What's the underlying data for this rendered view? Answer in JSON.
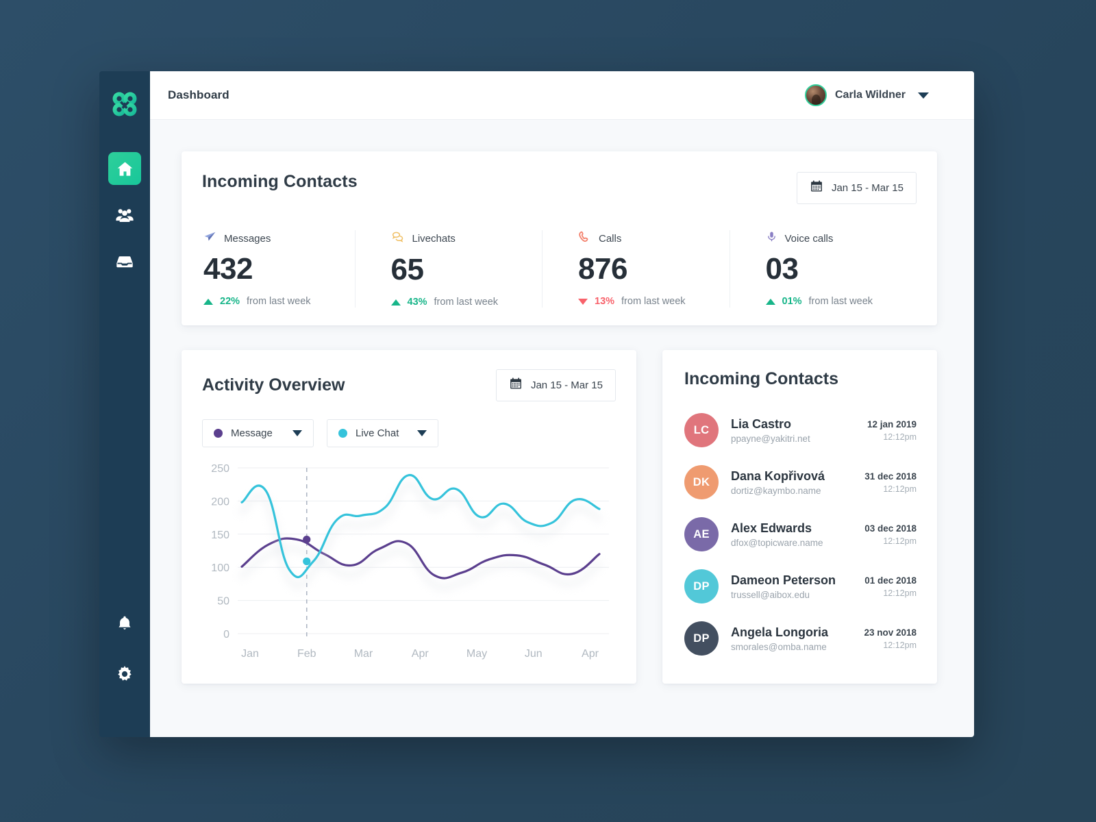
{
  "brand": {
    "logo_icon": "clover-logo-icon",
    "accent_green": "#2ecf9a",
    "sidebar_bg": "#1d3d55",
    "page_bg": "#2b4a63"
  },
  "sidebar": {
    "items": [
      {
        "name": "home",
        "icon": "home-icon",
        "active": true
      },
      {
        "name": "contacts",
        "icon": "people-icon",
        "active": false
      },
      {
        "name": "inbox",
        "icon": "inbox-icon",
        "active": false
      }
    ],
    "bottom_items": [
      {
        "name": "notifications",
        "icon": "bell-icon"
      },
      {
        "name": "settings",
        "icon": "gear-icon"
      }
    ]
  },
  "topbar": {
    "title": "Dashboard",
    "user_name": "Carla Wildner",
    "avatar_icon": "user-avatar",
    "caret_icon": "chevron-down-icon"
  },
  "stats_card": {
    "title": "Incoming Contacts",
    "daterange": {
      "icon": "calendar-icon",
      "value": "Jan 15 - Mar 15"
    },
    "metrics": [
      {
        "label": "Messages",
        "icon": "paper-plane-icon",
        "icon_color": "#7a8fd1",
        "value": "432",
        "direction": "up",
        "percent": "22%",
        "note": "from last week"
      },
      {
        "label": "Livechats",
        "icon": "chat-bubbles-icon",
        "icon_color": "#f2c46b",
        "value": "65",
        "direction": "up",
        "percent": "43%",
        "note": "from last week"
      },
      {
        "label": "Calls",
        "icon": "phone-icon",
        "icon_color": "#f3806b",
        "value": "876",
        "direction": "down",
        "percent": "13%",
        "note": "from last week"
      },
      {
        "label": "Voice calls",
        "icon": "microphone-icon",
        "icon_color": "#8a7fc4",
        "value": "03",
        "direction": "up",
        "percent": "01%",
        "note": "from last week"
      }
    ],
    "up_color": "#17b589",
    "down_color": "#f8626b"
  },
  "activity_card": {
    "title": "Activity Overview",
    "daterange": {
      "icon": "calendar-icon",
      "value": "Jan 15 - Mar 15"
    },
    "selectors": [
      {
        "label": "Message",
        "color": "#5b3f8e",
        "caret_icon": "chevron-down-icon"
      },
      {
        "label": "Live Chat",
        "color": "#35c3db",
        "caret_icon": "chevron-down-icon"
      }
    ]
  },
  "chart_data": {
    "type": "line",
    "title": "Activity Overview",
    "xlabel": "",
    "ylabel": "",
    "ylim": [
      0,
      250
    ],
    "yticks": [
      0,
      50,
      100,
      150,
      200,
      250
    ],
    "categories": [
      "Jan",
      "Feb",
      "Mar",
      "Apr",
      "May",
      "Jun",
      "Apr"
    ],
    "grid": true,
    "legend_position": "top-left",
    "marker_line": {
      "x_category": "Feb",
      "style": "dashed"
    },
    "series": [
      {
        "name": "Message",
        "color": "#5b3f8e",
        "marker_value": 142,
        "values": [
          101,
          135,
          142,
          120,
          103,
          128,
          136,
          88,
          92,
          112,
          118,
          104,
          90,
          120
        ]
      },
      {
        "name": "Live Chat",
        "color": "#35c3db",
        "marker_value": 109,
        "values": [
          198,
          216,
          96,
          109,
          172,
          178,
          190,
          239,
          203,
          218,
          176,
          196,
          168,
          167,
          202,
          188
        ]
      }
    ]
  },
  "contacts_card": {
    "title": "Incoming Contacts",
    "items": [
      {
        "initials": "LC",
        "color": "#e0757c",
        "name": "Lia Castro",
        "email": "ppayne@yakitri.net",
        "date": "12 jan 2019",
        "time": "12:12pm"
      },
      {
        "initials": "DK",
        "color": "#ef9b70",
        "name": "Dana Kopřivová",
        "email": "dortiz@kaymbo.name",
        "date": "31 dec 2018",
        "time": "12:12pm"
      },
      {
        "initials": "AE",
        "color": "#7a6aa8",
        "name": "Alex Edwards",
        "email": "dfox@topicware.name",
        "date": "03 dec 2018",
        "time": "12:12pm"
      },
      {
        "initials": "DP",
        "color": "#52c8d8",
        "name": "Dameon Peterson",
        "email": "trussell@aibox.edu",
        "date": "01 dec 2018",
        "time": "12:12pm"
      },
      {
        "initials": "DP",
        "color": "#434f60",
        "name": "Angela Longoria",
        "email": "smorales@omba.name",
        "date": "23 nov 2018",
        "time": "12:12pm"
      }
    ]
  }
}
